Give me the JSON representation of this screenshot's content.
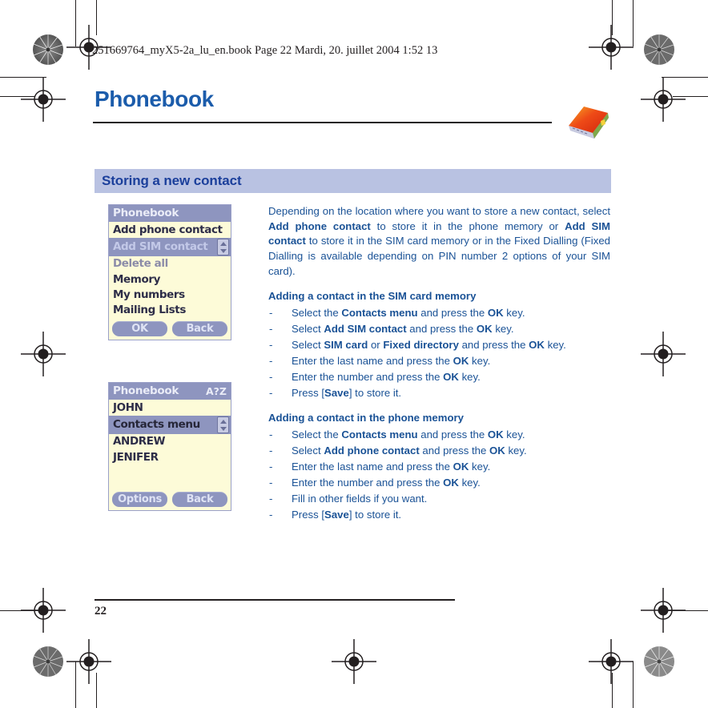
{
  "page_header": "251669764_myX5-2a_lu_en.book  Page 22  Mardi, 20. juillet 2004  1:52 13",
  "document": {
    "title": "Phonebook",
    "header_icon": "address-book-icon",
    "page_number": "22"
  },
  "section": {
    "banner_title": "Storing a new contact"
  },
  "screenshots": [
    {
      "name": "phonebook-contacts-menu-screen",
      "title": "Phonebook",
      "title_right": "",
      "rows": [
        {
          "label": "Add phone contact",
          "state": "normal"
        },
        {
          "label": "Add SIM contact",
          "state": "selected",
          "scroll_indicator": true
        },
        {
          "label": "Delete all",
          "state": "dimmed"
        },
        {
          "label": "Memory",
          "state": "normal"
        },
        {
          "label": "My numbers",
          "state": "normal"
        },
        {
          "label": "Mailing Lists",
          "state": "normal"
        }
      ],
      "softkeys": {
        "left": "OK",
        "right": "Back"
      }
    },
    {
      "name": "phonebook-list-screen",
      "title": "Phonebook",
      "title_right": "A?Z",
      "rows": [
        {
          "label": "JOHN",
          "state": "normal"
        },
        {
          "label": "Contacts menu",
          "state": "selected-dark",
          "scroll_indicator": true
        },
        {
          "label": "ANDREW",
          "state": "normal"
        },
        {
          "label": "JENIFER",
          "state": "normal"
        }
      ],
      "softkeys": {
        "left": "Options",
        "right": "Back"
      }
    }
  ],
  "body": {
    "intro_paragraph": [
      {
        "t": "Depending on the location where you want to store a new contact, select "
      },
      {
        "t": "Add phone contact",
        "b": true
      },
      {
        "t": " to store it in the phone memory or "
      },
      {
        "t": "Add SIM contact",
        "b": true
      },
      {
        "t": " to store it in the SIM card memory or in the Fixed Dialling (Fixed Dialling is available depending on PIN number 2 options of your SIM card)."
      }
    ],
    "sections": [
      {
        "heading": "Adding a contact in the SIM card memory",
        "bullet": "-",
        "steps": [
          [
            {
              "t": "Select the "
            },
            {
              "t": "Contacts menu",
              "b": true
            },
            {
              "t": " and press the "
            },
            {
              "t": "OK",
              "b": true
            },
            {
              "t": " key."
            }
          ],
          [
            {
              "t": "Select "
            },
            {
              "t": "Add SIM contact",
              "b": true
            },
            {
              "t": " and press the "
            },
            {
              "t": "OK",
              "b": true
            },
            {
              "t": " key."
            }
          ],
          [
            {
              "t": "Select "
            },
            {
              "t": "SIM card",
              "b": true
            },
            {
              "t": " or "
            },
            {
              "t": "Fixed directory",
              "b": true
            },
            {
              "t": " and press the "
            },
            {
              "t": "OK",
              "b": true
            },
            {
              "t": " key."
            }
          ],
          [
            {
              "t": "Enter the last name and press the "
            },
            {
              "t": "OK",
              "b": true
            },
            {
              "t": " key."
            }
          ],
          [
            {
              "t": "Enter the number and press the "
            },
            {
              "t": "OK",
              "b": true
            },
            {
              "t": " key."
            }
          ],
          [
            {
              "t": "Press ["
            },
            {
              "t": "Save",
              "b": true
            },
            {
              "t": "] to store it."
            }
          ]
        ]
      },
      {
        "heading": "Adding a contact in the phone memory",
        "bullet": "-",
        "steps": [
          [
            {
              "t": "Select the "
            },
            {
              "t": "Contacts menu",
              "b": true
            },
            {
              "t": " and press the "
            },
            {
              "t": "OK",
              "b": true
            },
            {
              "t": " key."
            }
          ],
          [
            {
              "t": "Select "
            },
            {
              "t": "Add phone contact",
              "b": true
            },
            {
              "t": " and press the "
            },
            {
              "t": "OK",
              "b": true
            },
            {
              "t": " key."
            }
          ],
          [
            {
              "t": "Enter the last name and press the "
            },
            {
              "t": "OK",
              "b": true
            },
            {
              "t": " key."
            }
          ],
          [
            {
              "t": "Enter the number and press the "
            },
            {
              "t": "OK",
              "b": true
            },
            {
              "t": " key."
            }
          ],
          [
            {
              "t": "Fill in other fields if you want."
            }
          ],
          [
            {
              "t": "Press ["
            },
            {
              "t": "Save",
              "b": true
            },
            {
              "t": "] to store it."
            }
          ]
        ]
      }
    ]
  },
  "print_marks": {
    "registration_targets": 9,
    "density_bursts": 4
  },
  "colors": {
    "heading_blue": "#1b5cab",
    "body_blue": "#1a5296",
    "banner_bg": "#b9c2e2",
    "banner_text": "#1b3f9b",
    "screen_bg": "#fdfbd8",
    "screen_chrome": "#8e95bf",
    "rule_black": "#231f20"
  }
}
